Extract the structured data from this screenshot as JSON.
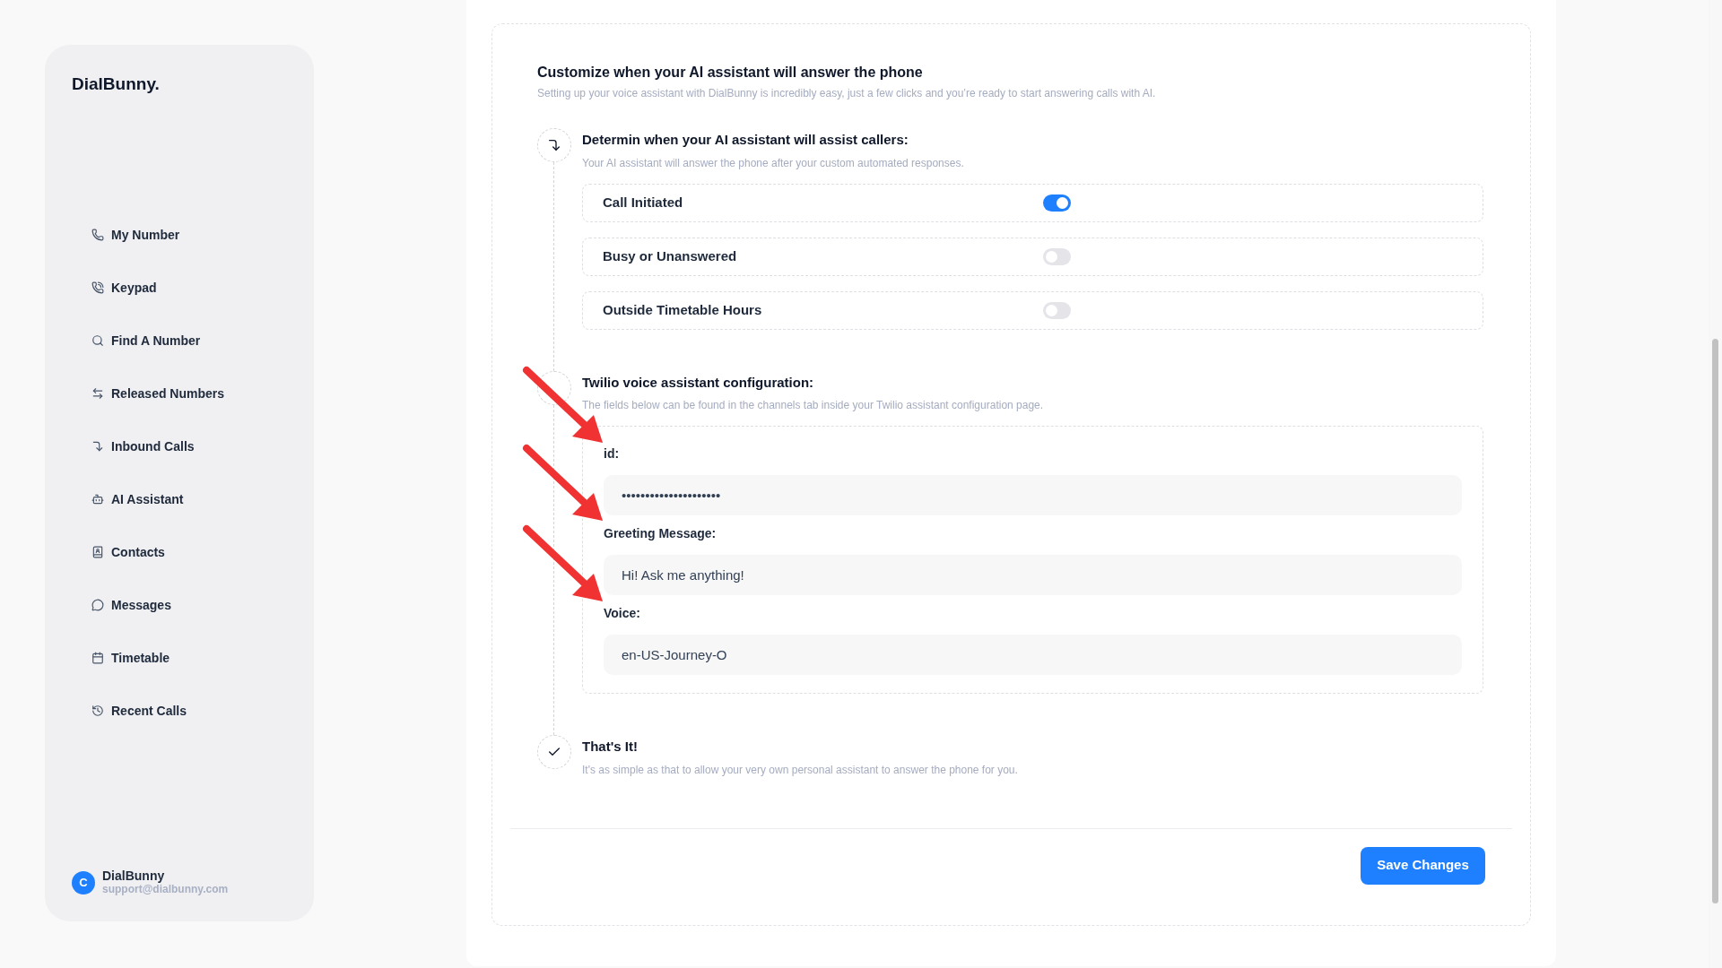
{
  "sidebar": {
    "brand": "DialBunny.",
    "items": [
      {
        "label": "My Number"
      },
      {
        "label": "Keypad"
      },
      {
        "label": "Find A Number"
      },
      {
        "label": "Released Numbers"
      },
      {
        "label": "Inbound Calls"
      },
      {
        "label": "AI Assistant"
      },
      {
        "label": "Contacts"
      },
      {
        "label": "Messages"
      },
      {
        "label": "Timetable"
      },
      {
        "label": "Recent Calls"
      }
    ],
    "user": {
      "initial": "C",
      "name": "DialBunny",
      "email": "support@dialbunny.com"
    }
  },
  "main": {
    "title": "Customize when your AI assistant will answer the phone",
    "subtitle": "Setting up your voice assistant with DialBunny is incredibly easy, just a few clicks and you’re ready to start answering calls with AI.",
    "steps": [
      {
        "kind": "toggles",
        "title": "Determin when your AI assistant will assist callers:",
        "description": "Your AI assistant will answer the phone after your custom automated responses.",
        "toggles": [
          {
            "label": "Call Initiated",
            "on": true
          },
          {
            "label": "Busy or Unanswered",
            "on": false
          },
          {
            "label": "Outside Timetable Hours",
            "on": false
          }
        ]
      },
      {
        "kind": "fields",
        "title": "Twilio voice assistant configuration:",
        "description": "The fields below can be found in the channels tab inside your Twilio assistant configuration page.",
        "fields": [
          {
            "label": "id:",
            "value": "•••••••••••••••••••••"
          },
          {
            "label": "Greeting Message:",
            "value": "Hi! Ask me anything!"
          },
          {
            "label": "Voice:",
            "value": "en-US-Journey-O"
          }
        ]
      },
      {
        "kind": "done",
        "title": "That's It!",
        "description": "It's as simple as that to allow your very own personal assistant to answer the phone for you."
      }
    ],
    "save_button": "Save Changes"
  }
}
